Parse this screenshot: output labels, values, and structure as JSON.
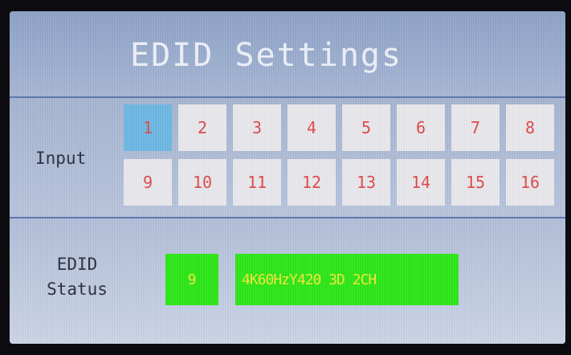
{
  "title": "EDID Settings",
  "input": {
    "label": "Input",
    "selected": "1",
    "buttons": [
      "1",
      "2",
      "3",
      "4",
      "5",
      "6",
      "7",
      "8",
      "9",
      "10",
      "11",
      "12",
      "13",
      "14",
      "15",
      "16"
    ]
  },
  "status": {
    "label_line1": "EDID",
    "label_line2": "Status",
    "input_number": "9",
    "edid_value": "4K60HzY420 3D 2CH"
  },
  "colors": {
    "selected_button": "#6fb9e6",
    "button": "#eae9ee",
    "button_text": "#e04a4a",
    "status_box": "#2ee819",
    "status_text": "#f3ea3a",
    "divider": "#5d79b0"
  }
}
